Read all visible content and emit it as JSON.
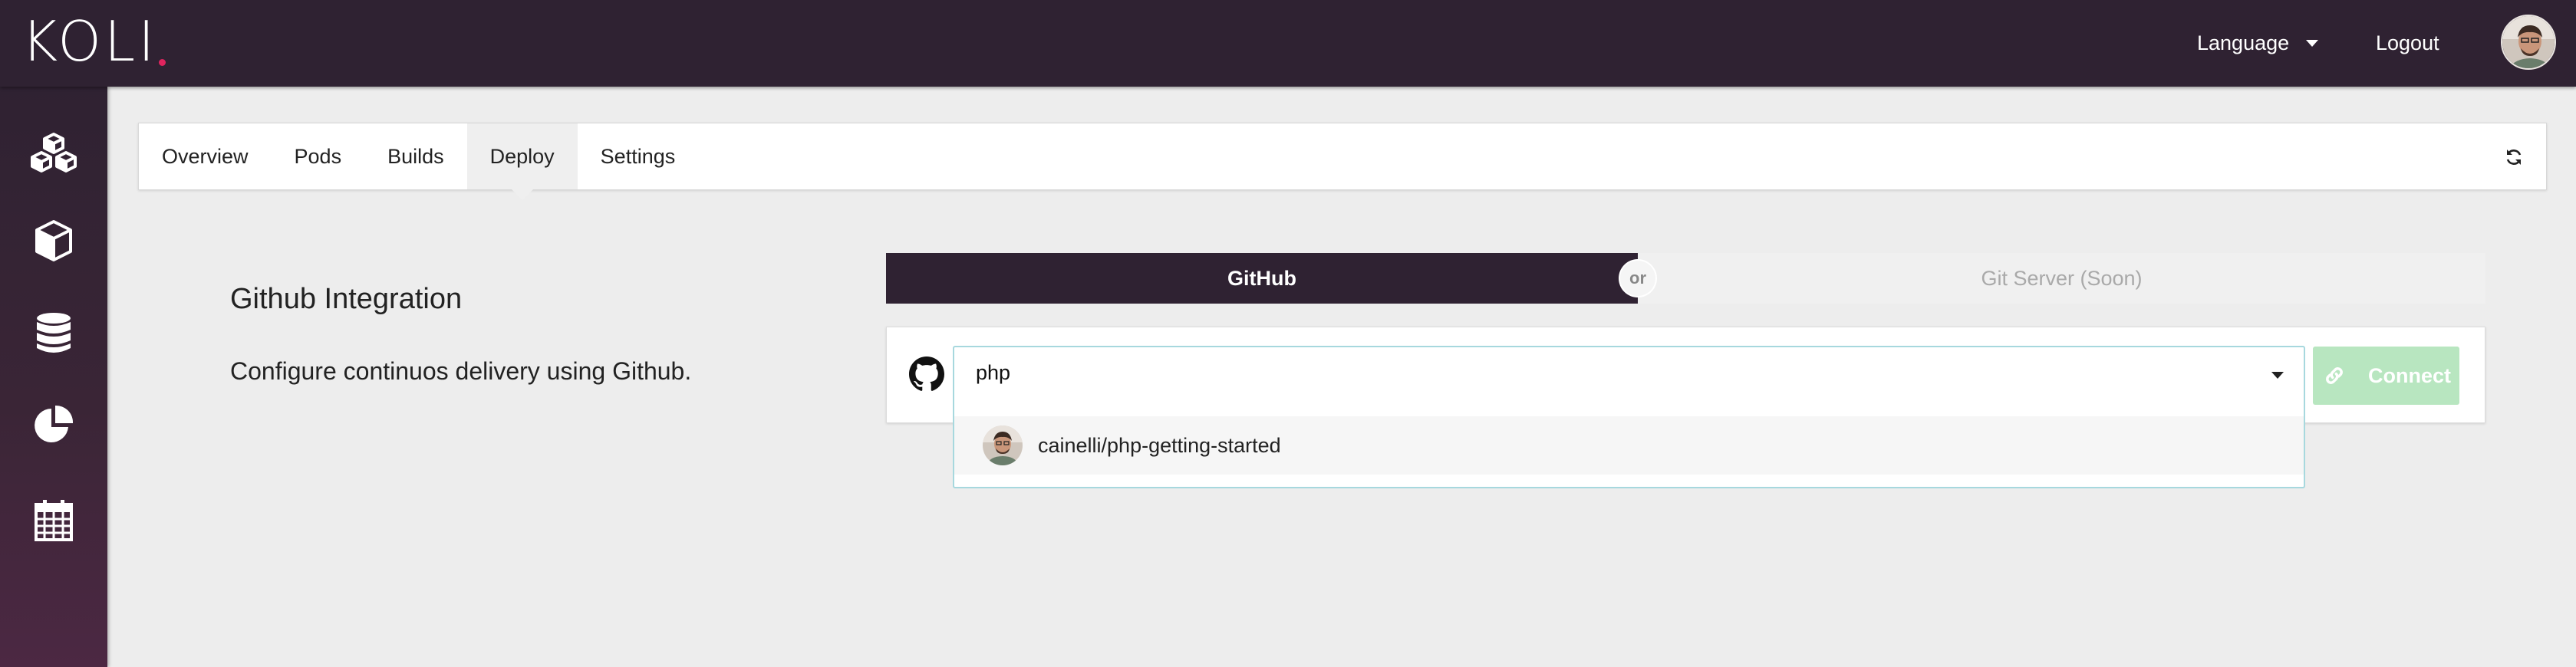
{
  "header": {
    "logo_text": "KOLI",
    "language_label": "Language",
    "logout_label": "Logout"
  },
  "sidebar": {
    "items": [
      {
        "icon": "cubes-icon"
      },
      {
        "icon": "cube-icon"
      },
      {
        "icon": "database-icon"
      },
      {
        "icon": "pie-chart-icon"
      },
      {
        "icon": "calendar-icon"
      }
    ]
  },
  "tabs": [
    "Overview",
    "Pods",
    "Builds",
    "Deploy",
    "Settings"
  ],
  "active_tab": "Deploy",
  "integration": {
    "title": "Github Integration",
    "description": "Configure continuos delivery using Github."
  },
  "switch": {
    "left_label": "GitHub",
    "or_label": "or",
    "right_label": "Git Server (Soon)"
  },
  "repo_select": {
    "value": "php",
    "options": [
      "cainelli/php-getting-started"
    ]
  },
  "connect_label": "Connect",
  "colors": {
    "topbar": "#2f2232",
    "accent_dot": "#e0245e",
    "select_border": "#a7d8de",
    "connect_disabled": "#b8e6c0"
  }
}
